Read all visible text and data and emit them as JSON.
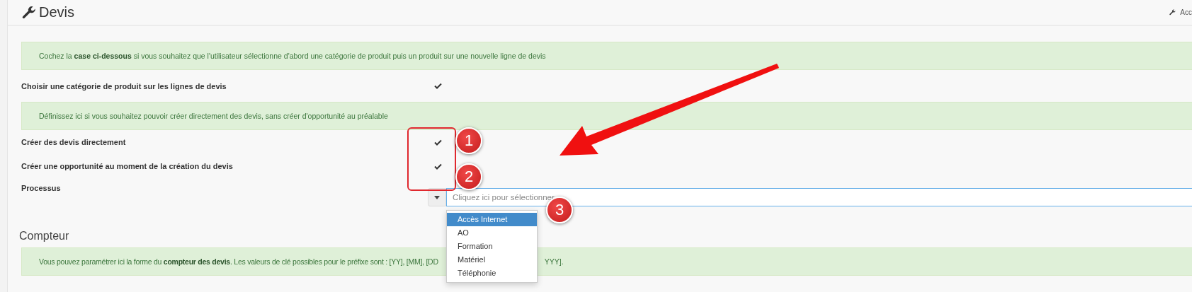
{
  "header": {
    "title": "Devis",
    "right_link": "Acc"
  },
  "settings": [
    {
      "kind": "alert",
      "text": "Cochez la **case ci-dessous** si vous souhaitez que l'utilisateur sélectionne d'abord une catégorie de produit puis un produit sur une nouvelle ligne de devis"
    },
    {
      "kind": "check",
      "label": "Choisir une catégorie de produit sur les lignes de devis",
      "checked": true
    },
    {
      "kind": "alert",
      "text": "Définissez ici si vous souhaitez pouvoir créer directement des devis, sans créer d'opportunité au préalable"
    },
    {
      "kind": "check",
      "label": "Créer des devis directement",
      "checked": true
    },
    {
      "kind": "check",
      "label": "Créer une opportunité au moment de la création du devis",
      "checked": true
    },
    {
      "kind": "select",
      "label": "Processus",
      "placeholder": "Cliquez ici pour sélectionner",
      "open": true,
      "options": [
        {
          "label": "Accès Internet",
          "selected": true
        },
        {
          "label": "AO",
          "selected": false
        },
        {
          "label": "Formation",
          "selected": false
        },
        {
          "label": "Matériel",
          "selected": false
        },
        {
          "label": "Téléphonie",
          "selected": false
        }
      ]
    }
  ],
  "counter": {
    "heading": "Compteur",
    "alert_before": "Vous pouvez paramétrer ici la forme du **compteur des devis**. Les valeurs de clé possibles pour le préfixe sont : [YY], [MM], [DD",
    "alert_after": "YYY]."
  },
  "annotations": {
    "badges": [
      "1",
      "2",
      "3"
    ]
  }
}
